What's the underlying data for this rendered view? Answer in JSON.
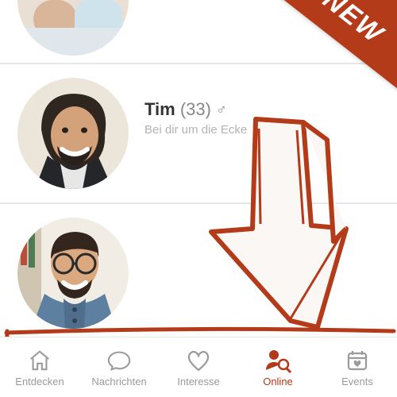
{
  "ribbon": {
    "label": "NEW"
  },
  "profiles": [
    {
      "name": "",
      "age": null,
      "gender": "",
      "sub": ""
    },
    {
      "name": "Tim",
      "age": 33,
      "gender": "♂",
      "sub": "Bei dir um die Ecke"
    },
    {
      "name": "",
      "age": null,
      "gender": "",
      "sub": ""
    }
  ],
  "nav": {
    "tabs": [
      {
        "label": "Entdecken",
        "icon": "home-icon",
        "active": false
      },
      {
        "label": "Nachrichten",
        "icon": "chat-icon",
        "active": false
      },
      {
        "label": "Interesse",
        "icon": "heart-icon",
        "active": false
      },
      {
        "label": "Online",
        "icon": "person-search-icon",
        "active": true
      },
      {
        "label": "Events",
        "icon": "calendar-heart-icon",
        "active": false
      }
    ]
  },
  "colors": {
    "accent": "#b43b1a",
    "muted": "#9a9a9a"
  }
}
